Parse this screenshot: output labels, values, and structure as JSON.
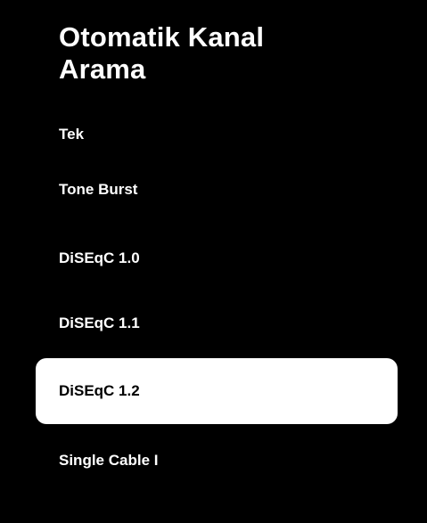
{
  "screen": {
    "title": "Otomatik Kanal Arama",
    "background_color": "#000000",
    "highlight_color": "#ffffff"
  },
  "menu": {
    "selected_index": 4,
    "items": [
      {
        "label": "Tek"
      },
      {
        "label": "Tone Burst"
      },
      {
        "label": "DiSEqC 1.0"
      },
      {
        "label": "DiSEqC 1.1"
      },
      {
        "label": "DiSEqC 1.2"
      },
      {
        "label": "Single Cable I"
      }
    ]
  }
}
